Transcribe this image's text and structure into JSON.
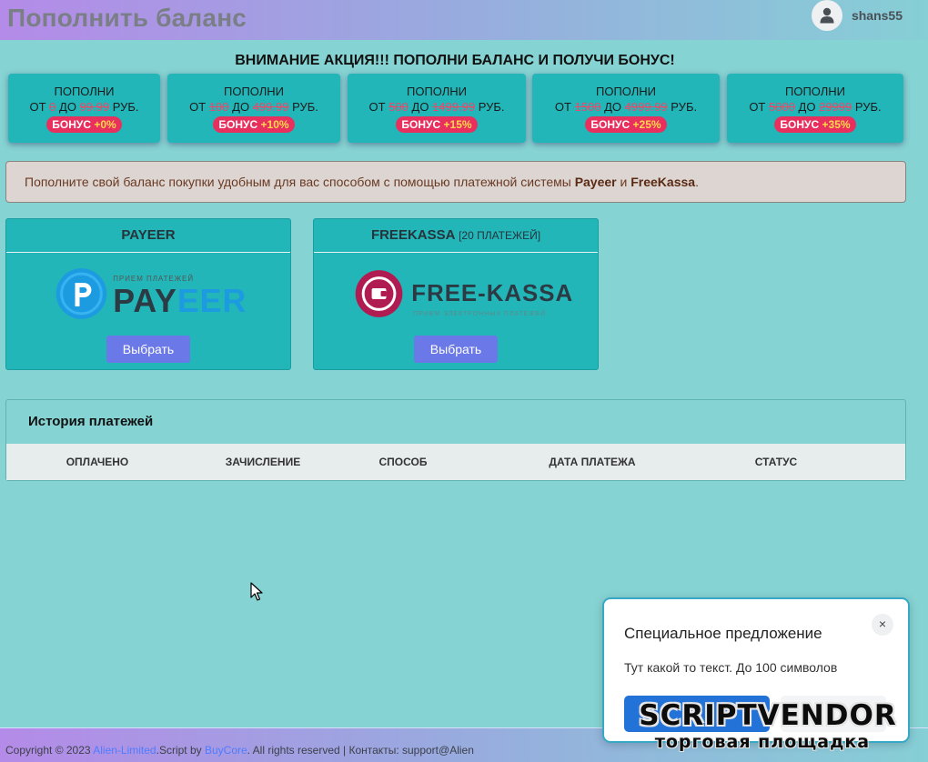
{
  "header": {
    "title": "Пополнить баланс",
    "username": "shans55"
  },
  "promo": {
    "title": "ВНИМАНИЕ АКЦИЯ!!! ПОПОЛНИ БАЛАНС И ПОЛУЧИ БОНУС!",
    "line1": "ПОПОЛНИ",
    "from_word": "ОТ",
    "to_word": "ДО",
    "currency": "РУБ.",
    "bonus_word": "БОНУС",
    "tiers": [
      {
        "min": "0",
        "max": "99.99",
        "bonus": "+0%"
      },
      {
        "min": "100",
        "max": "499.99",
        "bonus": "+10%"
      },
      {
        "min": "500",
        "max": "1499.99",
        "bonus": "+15%"
      },
      {
        "min": "1500",
        "max": "4999.99",
        "bonus": "+25%"
      },
      {
        "min": "5000",
        "max": "29999",
        "bonus": "+35%"
      }
    ]
  },
  "alert": {
    "text_before": "Пополните свой баланс покупки удобным для вас способом с помощью платежной системы ",
    "system1": "Payeer",
    "conj": " и ",
    "system2": "FreeKassa",
    "text_after": "."
  },
  "payments": {
    "payeer": {
      "title": "PAYEER",
      "logo_caption": "ПРИЕМ ПЛАТЕЖЕЙ",
      "logo_text_a": "PAY",
      "logo_text_b": "EER",
      "button": "Выбрать"
    },
    "freekassa": {
      "title": "FREEKASSA",
      "note": "[20 ПЛАТЕЖЕЙ]",
      "logo_text": "FREE-KASSA",
      "logo_caption": "ПРИЕМ ЭЛЕКТРОННЫХ ПЛАТЕЖЕЙ",
      "button": "Выбрать"
    }
  },
  "history": {
    "title": "История платежей",
    "columns": [
      "ОПЛАЧЕНО",
      "ЗАЧИСЛЕНИЕ",
      "СПОСОБ",
      "ДАТА ПЛАТЕЖА",
      "СТАТУС"
    ]
  },
  "footer": {
    "copyright": "Copyright © 2023 ",
    "brand": "Alien-Limited",
    "script_by": ".Script by ",
    "buycore": "BuyCore",
    "rest": ". All rights reserved | Контакты: support@Alien"
  },
  "modal": {
    "title": "Специальное предложение",
    "text": "Тут какой то текст. До 100 символов",
    "close": "×"
  },
  "watermark": {
    "top": "SCRIPTVENDOR",
    "bottom": "торговая площадка"
  },
  "colors": {
    "accent": "#22b6b9",
    "button": "#6b78e8",
    "bonus": "#e8305f",
    "background": "#86d3d3"
  }
}
